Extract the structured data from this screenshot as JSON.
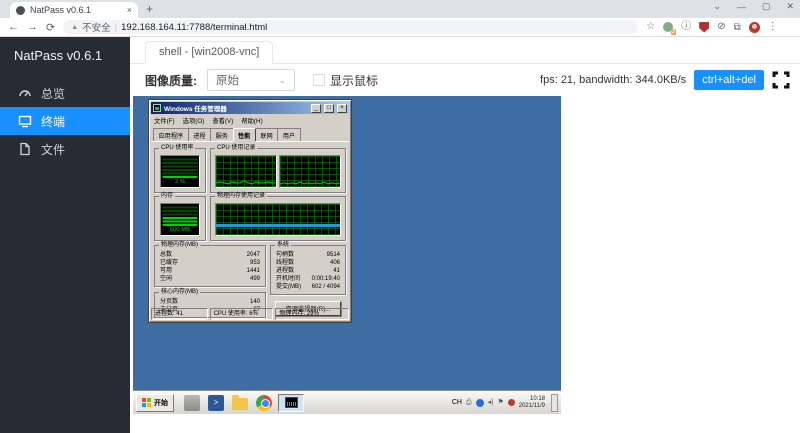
{
  "colors": {
    "accent": "#1890ff",
    "desktop_blue": "#3d6da3",
    "sidebar_bg": "#272b34",
    "classic_face": "#d4d0c8"
  },
  "browser": {
    "tab_title": "NatPass v0.6.1",
    "not_secure": "不安全",
    "url": "192.168.164.11:7788/terminal.html",
    "extension_badge": "2"
  },
  "icons": {
    "tab_close": "×",
    "new_tab": "+",
    "tab_search": "⌄",
    "minimize": "—",
    "maximize": "▢",
    "close": "✕",
    "back": "←",
    "forward": "→",
    "reload": "⟳",
    "warning": "▲",
    "divider": "|",
    "star": "☆",
    "info": "ⓘ",
    "blocker": "⊘",
    "puzzle": "⧉",
    "menu": "⋮",
    "select_chevron": "⌄",
    "win_min": "_",
    "win_max": "□",
    "win_close": "×",
    "flag": "⚑",
    "printer": "⎙",
    "volume": "◂)"
  },
  "sidebar": {
    "title": "NatPass v0.6.1",
    "items": [
      {
        "label": "总览"
      },
      {
        "label": "终端"
      },
      {
        "label": "文件"
      }
    ]
  },
  "main": {
    "shell_tab": "shell - [win2008-vnc]",
    "toolbar": {
      "quality_label": "图像质量:",
      "quality_value": "原始",
      "show_cursor_label": "显示鼠标",
      "stats": "fps: 21, bandwidth: 344.0KB/s",
      "cad_label": "ctrl+alt+del"
    }
  },
  "vnc": {
    "taskmgr": {
      "title": "Windows 任务管理器",
      "menu": [
        "文件(F)",
        "选项(O)",
        "查看(V)",
        "帮助(H)"
      ],
      "tabs": [
        "应用程序",
        "进程",
        "服务",
        "性能",
        "联网",
        "用户"
      ],
      "active_tab": "性能",
      "cpu_group": "CPU 使用率",
      "cpu_meter_text": "2 %",
      "cpu_history_group": "CPU 使用记录",
      "mem_group": "内存",
      "mem_meter_text": "600 MB",
      "mem_history_group": "物理内存使用记录",
      "phys_group": "物理内存(MB)",
      "phys_rows": [
        {
          "label": "总数",
          "value": "2047"
        },
        {
          "label": "已缓存",
          "value": "953"
        },
        {
          "label": "可用",
          "value": "1441"
        },
        {
          "label": "空闲",
          "value": "499"
        }
      ],
      "kernel_group": "核心内存(MB)",
      "kernel_rows": [
        {
          "label": "分页数",
          "value": "140"
        },
        {
          "label": "未分页",
          "value": "27"
        }
      ],
      "system_group": "系统",
      "system_rows": [
        {
          "label": "句柄数",
          "value": "9514"
        },
        {
          "label": "线程数",
          "value": "406"
        },
        {
          "label": "进程数",
          "value": "41"
        },
        {
          "label": "开机时间",
          "value": "0:00:19:40"
        },
        {
          "label": "提交(MB)",
          "value": "602 / 4094"
        }
      ],
      "resmon_button": "资源监视器(R)...",
      "status_cells": [
        "进程数: 41",
        "CPU 使用率: 6%",
        "物理内存: 29%"
      ]
    },
    "taskbar": {
      "start_label": "开始",
      "lang_indicator": "CH",
      "clock_time": "10:18",
      "clock_date": "2021/11/9"
    }
  }
}
